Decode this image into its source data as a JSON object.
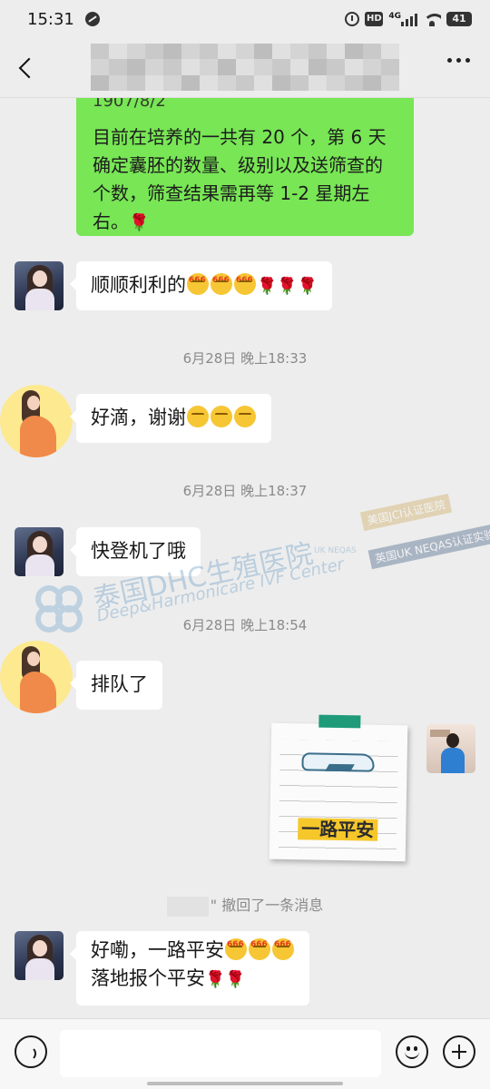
{
  "status_bar": {
    "time": "15:31",
    "hd": "HD",
    "network": "4G",
    "battery": "41"
  },
  "header": {
    "back_icon": "chevron-left-icon",
    "more_icon": "more-dots-icon"
  },
  "messages": {
    "m1_cut_text": "1907/8/2",
    "m1_text": "目前在培养的一共有 20 个，第 6 天确定囊胚的数量、级别以及送筛查的个数，筛查结果需再等 1-2 星期左右。",
    "m2_text": "顺顺利利的",
    "m3_text": "好滴，谢谢",
    "m4_text": "快登机了哦",
    "m5_text": "排队了",
    "m6_line1": "好嘞，一路平安",
    "m6_line2": "落地报个平安"
  },
  "timestamps": {
    "t1": "6月28日 晚上18:33",
    "t2": "6月28日 晚上18:37",
    "t3": "6月28日 晚上18:54"
  },
  "sticker": {
    "text": "一路平安"
  },
  "recall": {
    "suffix": "\" 撤回了一条消息"
  },
  "watermark": {
    "cn": "泰国DHC生殖医院",
    "en": "Deep&Harmonicare IVF Center",
    "badge1": "美国JCI认证医院",
    "badge2": "英国UK NEQAS认证实验室",
    "neqas": "UK NEQAS"
  },
  "colors": {
    "background": "#ededed",
    "bubble_green": "#78e655",
    "bubble_white": "#ffffff",
    "timestamp": "#8a8a8a"
  }
}
